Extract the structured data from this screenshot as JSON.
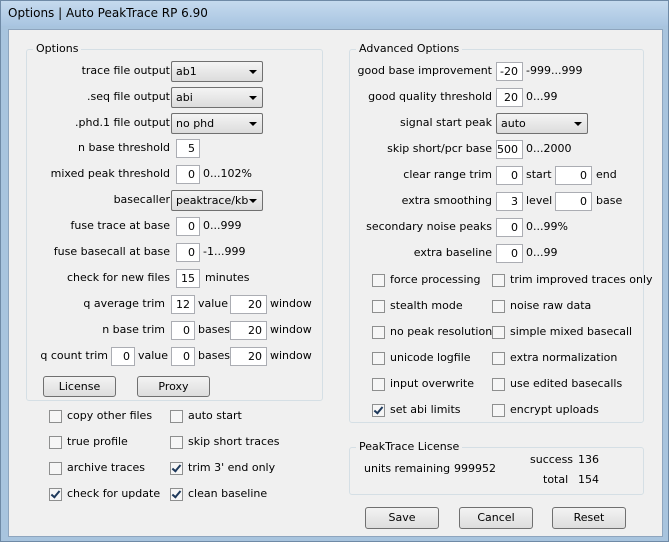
{
  "window": {
    "title": "Options | Auto PeakTrace RP 6.90"
  },
  "options": {
    "title": "Options",
    "trace_file_output": {
      "label": "trace file output",
      "value": "ab1"
    },
    "seq_file_output": {
      "label": ".seq file output",
      "value": "abi"
    },
    "phd_file_output": {
      "label": ".phd.1 file output",
      "value": "no phd"
    },
    "n_base_threshold": {
      "label": "n base threshold",
      "value": "5"
    },
    "mixed_peak_threshold": {
      "label": "mixed peak threshold",
      "value": "0",
      "range": "0...102%"
    },
    "basecaller": {
      "label": "basecaller",
      "value": "peaktrace/kb"
    },
    "fuse_trace_at_base": {
      "label": "fuse trace at base",
      "value": "0",
      "range": "0...999"
    },
    "fuse_basecall_at_base": {
      "label": "fuse basecall at base",
      "value": "0",
      "range": "-1...999"
    },
    "check_new_files": {
      "label": "check for new files",
      "value": "15",
      "unit": "minutes"
    },
    "q_average_trim": {
      "label": "q average trim",
      "value": "12",
      "value_label": "value",
      "window": "20",
      "window_label": "window"
    },
    "n_base_trim": {
      "label": "n base trim",
      "value": "0",
      "bases_label": "bases",
      "window": "20",
      "window_label": "window"
    },
    "q_count_trim": {
      "label": "q count trim",
      "value": "0",
      "value_label": "value",
      "bases": "0",
      "bases_label": "bases",
      "window": "20",
      "window_label": "window"
    },
    "license_button": "License",
    "proxy_button": "Proxy",
    "checkboxes": {
      "copy_other_files": {
        "label": "copy other files",
        "checked": false
      },
      "auto_start": {
        "label": "auto start",
        "checked": false
      },
      "true_profile": {
        "label": "true profile",
        "checked": false
      },
      "skip_short_traces": {
        "label": "skip short traces",
        "checked": false
      },
      "archive_traces": {
        "label": "archive traces",
        "checked": false
      },
      "trim_3_end_only": {
        "label": "trim 3' end only",
        "checked": true
      },
      "check_for_update": {
        "label": "check for update",
        "checked": true
      },
      "clean_baseline": {
        "label": "clean baseline",
        "checked": true
      }
    }
  },
  "advanced": {
    "title": "Advanced Options",
    "good_base_improvement": {
      "label": "good base improvement",
      "value": "-20",
      "range": "-999...999"
    },
    "good_quality_threshold": {
      "label": "good quality threshold",
      "value": "20",
      "range": "0...99"
    },
    "signal_start_peak": {
      "label": "signal start peak",
      "value": "auto"
    },
    "skip_short_pcr_base": {
      "label": "skip short/pcr base",
      "value": "500",
      "range": "0...2000"
    },
    "clear_range_trim": {
      "label": "clear range trim",
      "start": "0",
      "start_label": "start",
      "end": "0",
      "end_label": "end"
    },
    "extra_smoothing": {
      "label": "extra smoothing",
      "level": "3",
      "level_label": "level",
      "base": "0",
      "base_label": "base"
    },
    "secondary_noise_peaks": {
      "label": "secondary noise peaks",
      "value": "0",
      "range": "0...99%"
    },
    "extra_baseline": {
      "label": "extra baseline",
      "value": "0",
      "range": "0...99"
    },
    "checkboxes": {
      "force_processing": {
        "label": "force processing",
        "checked": false
      },
      "trim_improved_traces_only": {
        "label": "trim improved traces only",
        "checked": false
      },
      "stealth_mode": {
        "label": "stealth mode",
        "checked": false
      },
      "noise_raw_data": {
        "label": "noise raw data",
        "checked": false
      },
      "no_peak_resolution": {
        "label": "no peak resolution",
        "checked": false
      },
      "simple_mixed_basecall": {
        "label": "simple mixed basecall",
        "checked": false
      },
      "unicode_logfile": {
        "label": "unicode logfile",
        "checked": false
      },
      "extra_normalization": {
        "label": "extra normalization",
        "checked": false
      },
      "input_overwrite": {
        "label": "input overwrite",
        "checked": false
      },
      "use_edited_basecalls": {
        "label": "use edited basecalls",
        "checked": false
      },
      "set_abi_limits": {
        "label": "set abi limits",
        "checked": true
      },
      "encrypt_uploads": {
        "label": "encrypt uploads",
        "checked": false
      }
    }
  },
  "license": {
    "title": "PeakTrace License",
    "units_remaining_label": "units remaining",
    "units_remaining": "999952",
    "success_label": "success",
    "success": "136",
    "total_label": "total",
    "total": "154"
  },
  "buttons": {
    "save": "Save",
    "cancel": "Cancel",
    "reset": "Reset"
  },
  "colors": {
    "title_bar": "#a9c5e1",
    "dialog_bg": "#f0f0f0",
    "check_mark": "#1e395b"
  }
}
